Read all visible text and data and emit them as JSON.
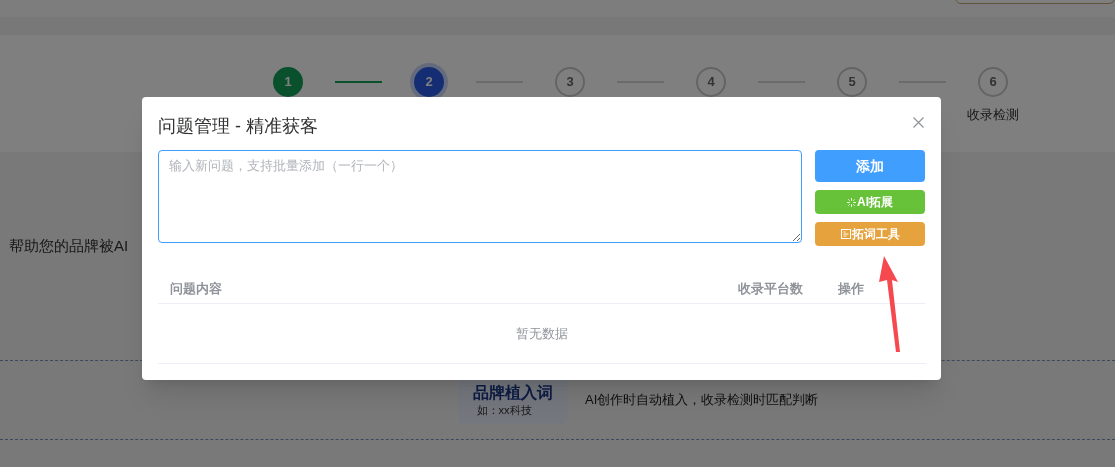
{
  "steps": [
    {
      "number": "1",
      "done": true,
      "selected": false
    },
    {
      "number": "2",
      "done": false,
      "selected": true
    },
    {
      "number": "3",
      "done": false,
      "selected": false
    },
    {
      "number": "4",
      "done": false,
      "selected": false
    },
    {
      "number": "5",
      "done": false,
      "selected": false
    },
    {
      "number": "6",
      "done": false,
      "selected": false,
      "label": "收录检测"
    }
  ],
  "intro_text": "帮助您的品牌被AI",
  "brand_term": {
    "title": "品牌植入词",
    "example": "如：xx科技",
    "description": "AI创作时自动植入，收录检测时匹配判断"
  },
  "dialog": {
    "title": "问题管理 - 精准获客",
    "input": {
      "placeholder": "输入新问题，支持批量添加（一行一个）"
    },
    "buttons": [
      {
        "kind": "primary",
        "label": "添加"
      },
      {
        "kind": "ai",
        "label": "AI拓展"
      },
      {
        "kind": "tool",
        "label": "拓词工具"
      }
    ],
    "table": {
      "columns": [
        "问题内容",
        "收录平台数",
        "操作"
      ],
      "empty_text": "暂无数据"
    }
  }
}
